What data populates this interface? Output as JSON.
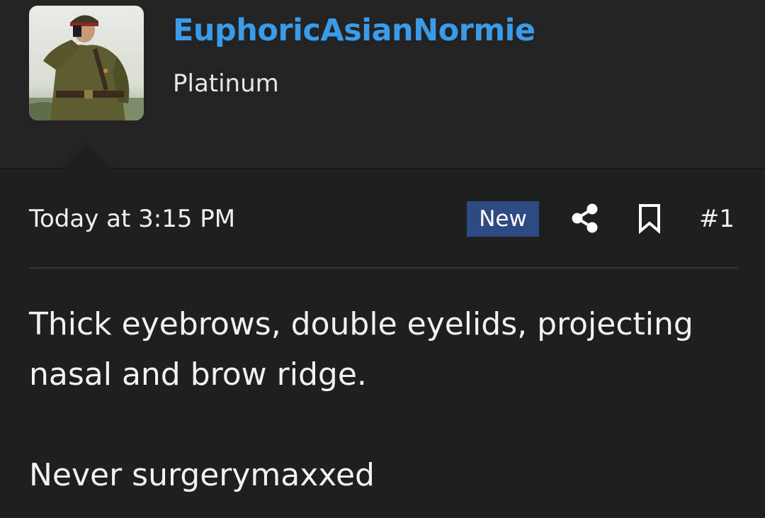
{
  "user": {
    "name": "EuphoricAsianNormie",
    "title": "Platinum",
    "avatar_icon": "user-avatar-photo",
    "name_color": "#3a9bea"
  },
  "post": {
    "timestamp": "Today at 3:15 PM",
    "badge": "New",
    "badge_color": "#2d4a82",
    "share_icon": "share-icon",
    "bookmark_icon": "bookmark-icon",
    "number": "#1",
    "paragraphs": [
      "Thick eyebrows, double eyelids, projecting nasal and brow ridge.",
      "Never surgerymaxxed"
    ]
  }
}
